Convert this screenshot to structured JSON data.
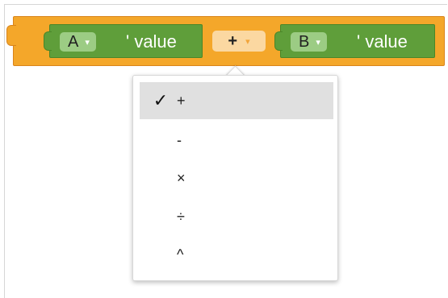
{
  "block": {
    "left_var": {
      "name": "A",
      "arrow": "▾",
      "suffix": "' value"
    },
    "operator": {
      "current": "+",
      "arrow": "▾"
    },
    "right_var": {
      "name": "B",
      "arrow": "▾",
      "suffix": "' value"
    }
  },
  "menu": {
    "items": [
      {
        "label": "+",
        "check": "✓",
        "selected": true
      },
      {
        "label": "-",
        "check": "",
        "selected": false
      },
      {
        "label": "×",
        "check": "",
        "selected": false
      },
      {
        "label": "÷",
        "check": "",
        "selected": false
      },
      {
        "label": "^",
        "check": "",
        "selected": false
      }
    ]
  },
  "colors": {
    "math_block": "#f4a72a",
    "value_block": "#5f9e3a",
    "var_dropdown": "#9ccc84",
    "op_dropdown": "#fbd8a1"
  }
}
